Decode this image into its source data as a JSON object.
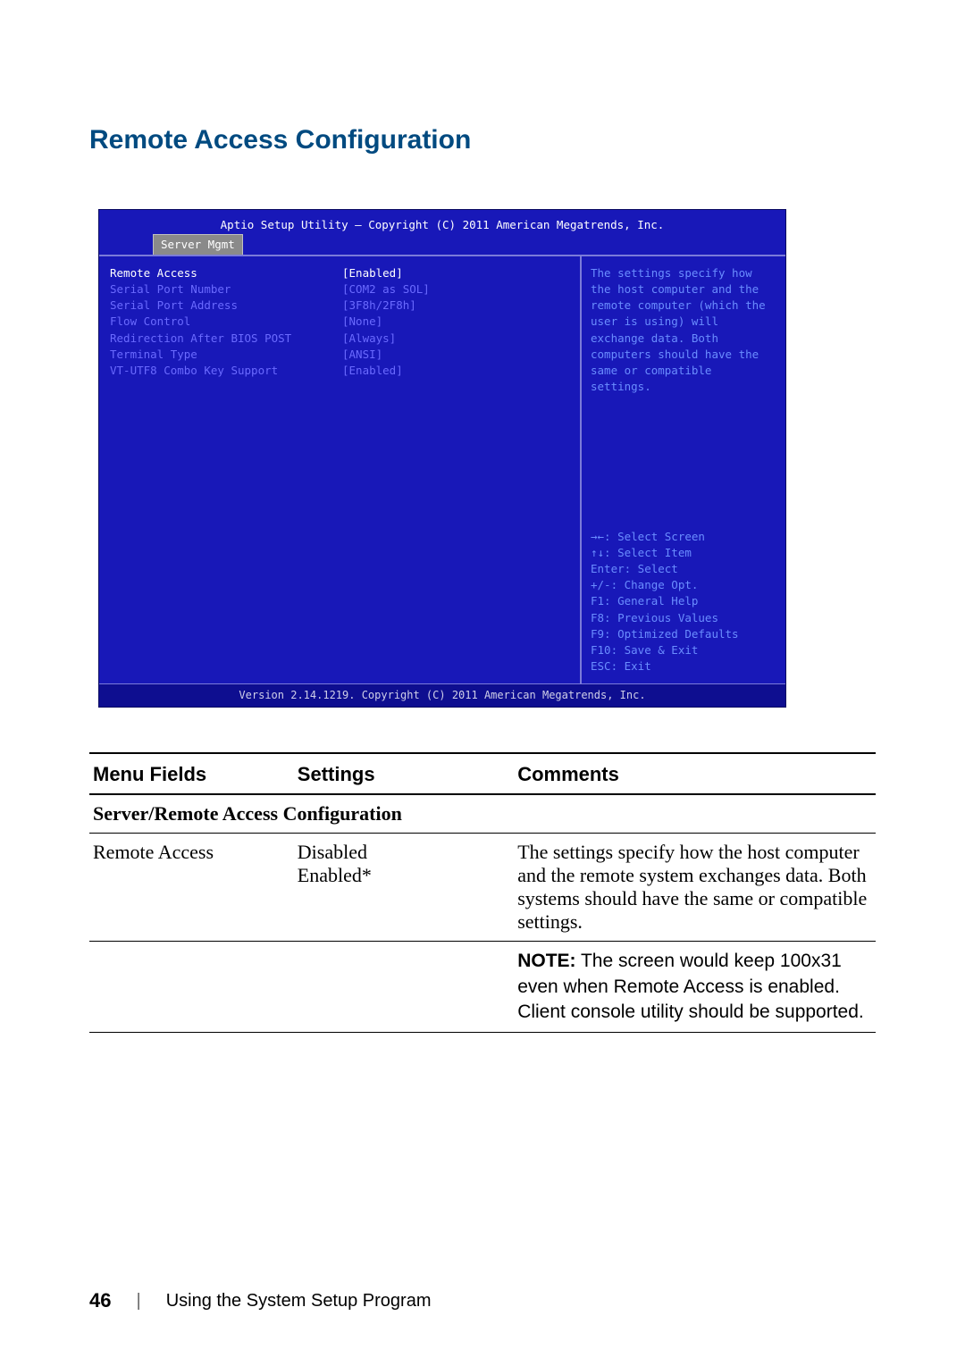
{
  "title": "Remote Access Configuration",
  "bios": {
    "header_title": "Aptio Setup Utility – Copyright (C) 2011 American Megatrends, Inc.",
    "tab": "Server Mgmt",
    "rows": [
      {
        "label": "Remote Access",
        "value": "[Enabled]"
      },
      {
        "label": "Serial Port Number",
        "value": "[COM2 as SOL]"
      },
      {
        "label": "Serial Port Address",
        "value": "[3F8h/2F8h]"
      },
      {
        "label": "Flow Control",
        "value": "[None]"
      },
      {
        "label": "Redirection After BIOS POST",
        "value": "[Always]"
      },
      {
        "label": "Terminal Type",
        "value": "[ANSI]"
      },
      {
        "label": "VT-UTF8 Combo Key Support",
        "value": "[Enabled]"
      }
    ],
    "help_text": "The settings specify how the host computer and the remote computer (which the user is using) will exchange data. Both computers should have the same or compatible settings.",
    "keys": [
      "→←: Select Screen",
      "↑↓: Select Item",
      "Enter: Select",
      "+/-: Change Opt.",
      "F1: General Help",
      "F8: Previous Values",
      "F9: Optimized Defaults",
      "F10: Save & Exit",
      "ESC: Exit"
    ],
    "footer": "Version 2.14.1219. Copyright (C) 2011 American Megatrends, Inc."
  },
  "table": {
    "headers": {
      "menu": "Menu Fields",
      "settings": "Settings",
      "comments": "Comments"
    },
    "section_title": "Server/Remote Access Configuration",
    "row": {
      "menu": "Remote Access",
      "settings_lines": [
        "Disabled",
        "Enabled*"
      ],
      "comments": "The settings specify how the host computer and the remote system exchanges data. Both systems should have the same or compatible settings."
    },
    "note_label": "NOTE:",
    "note_text": " The screen would keep 100x31 even when Remote Access is enabled. Client console utility should be supported."
  },
  "footer": {
    "page_number": "46",
    "chapter": "Using the System Setup Program"
  }
}
